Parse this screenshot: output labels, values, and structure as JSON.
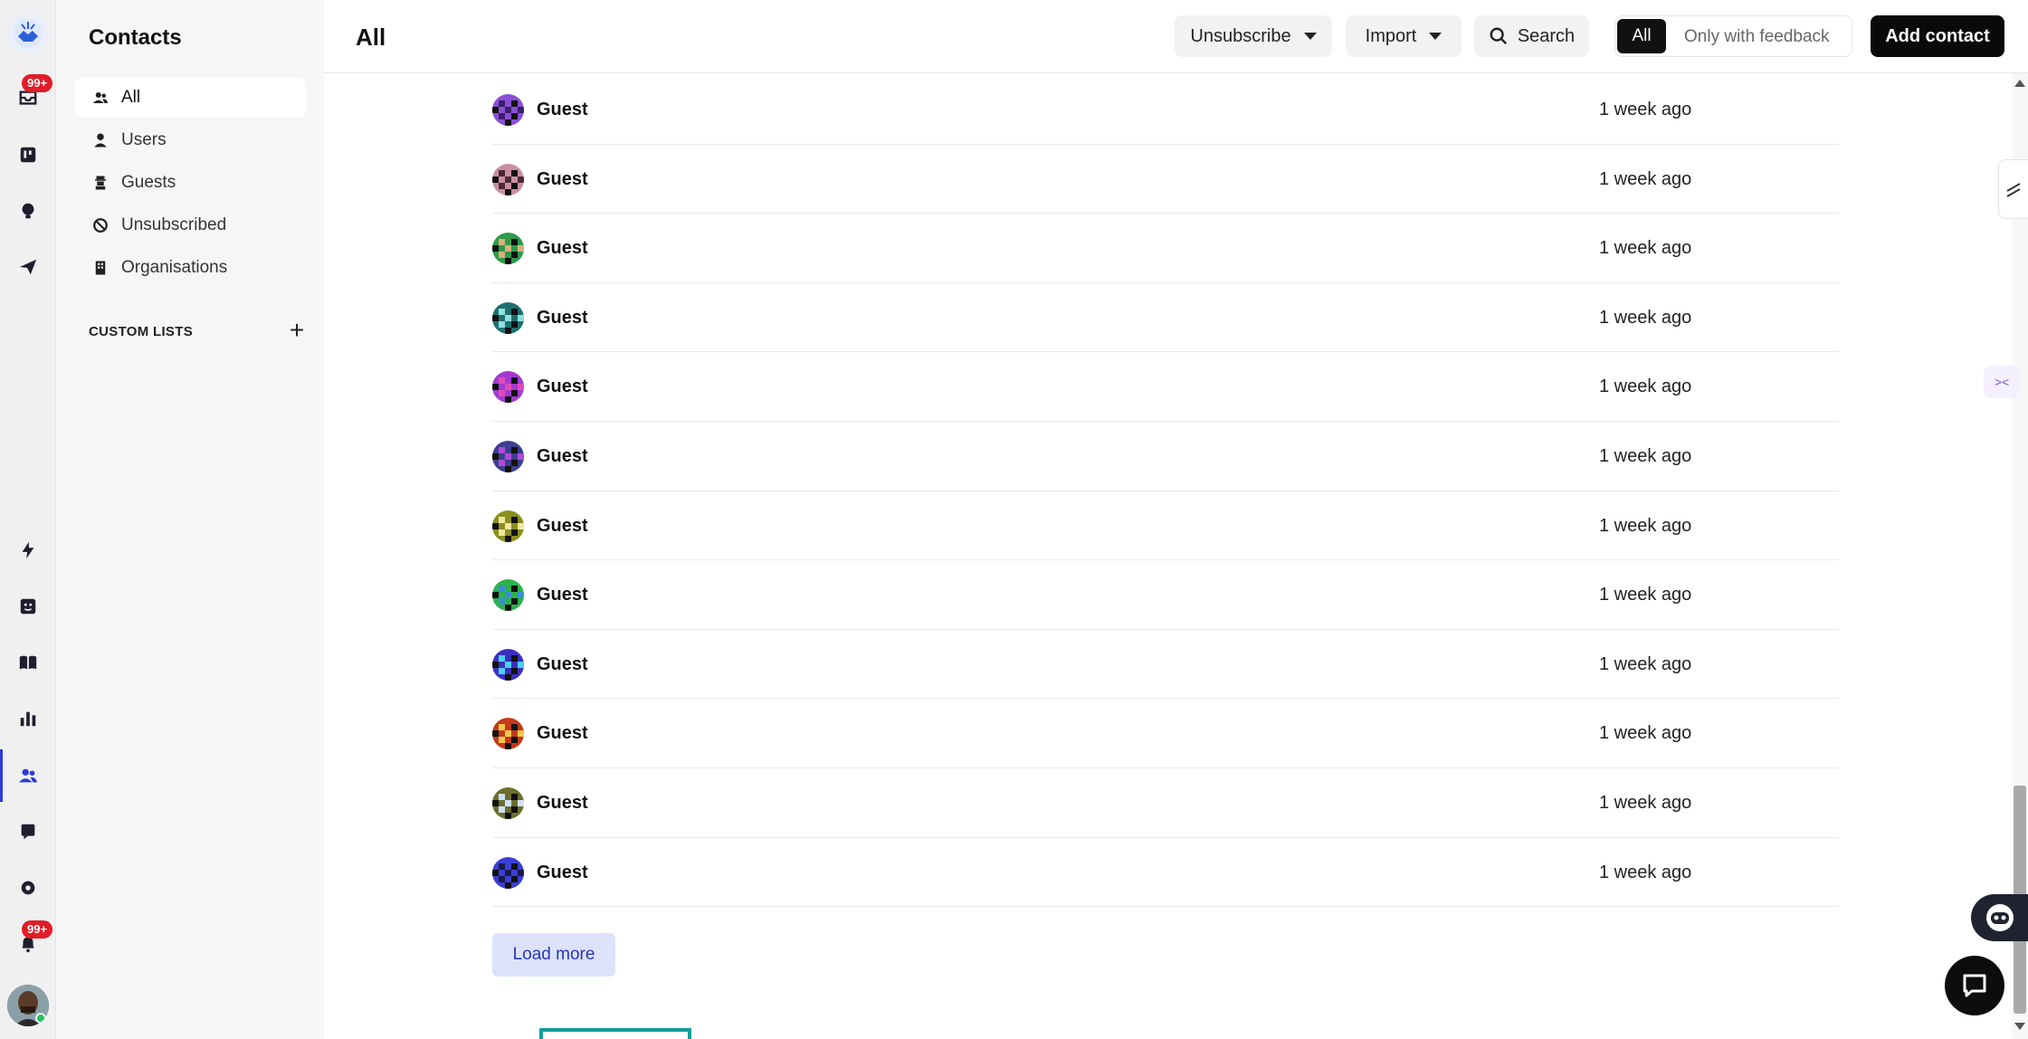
{
  "sidebar": {
    "title": "Contacts",
    "items": [
      {
        "label": "All",
        "icon": "users-icon",
        "active": true
      },
      {
        "label": "Users",
        "icon": "user-icon",
        "active": false
      },
      {
        "label": "Guests",
        "icon": "guest-icon",
        "active": false
      },
      {
        "label": "Unsubscribed",
        "icon": "ban-icon",
        "active": false
      },
      {
        "label": "Organisations",
        "icon": "building-icon",
        "active": false
      }
    ],
    "custom_lists_label": "CUSTOM LISTS"
  },
  "rail": {
    "inbox_badge": "99+",
    "notifications_badge": "99+"
  },
  "header": {
    "title": "All",
    "unsubscribe_label": "Unsubscribe",
    "import_label": "Import",
    "search_label": "Search",
    "filter_all": "All",
    "filter_feedback": "Only with feedback",
    "add_contact_label": "Add contact"
  },
  "contacts": [
    {
      "name": "Guest",
      "time": "1 week ago",
      "color_a": "#8a4fd6",
      "color_b": "#3a1f6a"
    },
    {
      "name": "Guest",
      "time": "1 week ago",
      "color_a": "#c98fa3",
      "color_b": "#4a2a35"
    },
    {
      "name": "Guest",
      "time": "1 week ago",
      "color_a": "#2f9a4a",
      "color_b": "#d8b07a"
    },
    {
      "name": "Guest",
      "time": "1 week ago",
      "color_a": "#1f6f6f",
      "color_b": "#8ee0e0"
    },
    {
      "name": "Guest",
      "time": "1 week ago",
      "color_a": "#a23ad1",
      "color_b": "#e24ab8"
    },
    {
      "name": "Guest",
      "time": "1 week ago",
      "color_a": "#3b3f8f",
      "color_b": "#b04ad6"
    },
    {
      "name": "Guest",
      "time": "1 week ago",
      "color_a": "#8b8f1f",
      "color_b": "#f0e6a0"
    },
    {
      "name": "Guest",
      "time": "1 week ago",
      "color_a": "#2bb34a",
      "color_b": "#3a8fd0"
    },
    {
      "name": "Guest",
      "time": "1 week ago",
      "color_a": "#3a2fbf",
      "color_b": "#4ad0f0"
    },
    {
      "name": "Guest",
      "time": "1 week ago",
      "color_a": "#c43a1a",
      "color_b": "#f0c84a"
    },
    {
      "name": "Guest",
      "time": "1 week ago",
      "color_a": "#6b6f2a",
      "color_b": "#cfe0ff"
    },
    {
      "name": "Guest",
      "time": "1 week ago",
      "color_a": "#3a3fd6",
      "color_b": "#1a1a4a"
    }
  ],
  "load_more_label": "Load more",
  "colors": {
    "accent": "#2b3bd9",
    "badge": "#e11d2a",
    "load_more_bg": "#dde2fb"
  }
}
